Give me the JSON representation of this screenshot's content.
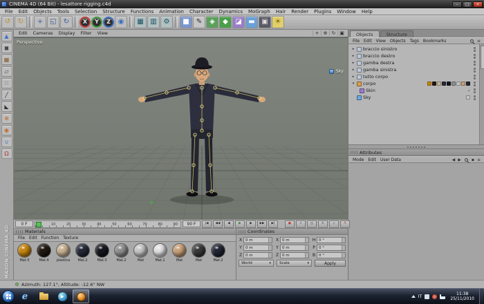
{
  "window": {
    "title": "CINEMA 4D (64 Bit) - lesattore rigging.c4d",
    "minimize": "–",
    "maximize": "□",
    "close": "×"
  },
  "menu_bar": {
    "items": [
      "File",
      "Edit",
      "Objects",
      "Tools",
      "Selection",
      "Structure",
      "Functions",
      "Animation",
      "Character",
      "Dynamics",
      "MoGraph",
      "Hair",
      "Render",
      "Plugins",
      "Window",
      "Help"
    ]
  },
  "toolbar": {
    "icons": [
      {
        "name": "undo",
        "glyph": "↺",
        "fg": "#b8922e",
        "bg": "#bdbdbd"
      },
      {
        "name": "redo",
        "glyph": "↻",
        "fg": "#b8922e",
        "bg": "#bdbdbd"
      },
      {
        "name": "move",
        "glyph": "+",
        "fg": "#3f5e9e",
        "bg": "#bdbdbd"
      },
      {
        "name": "scale",
        "glyph": "◱",
        "fg": "#3f5e9e",
        "bg": "#bdbdbd"
      },
      {
        "name": "rotate",
        "glyph": "↻",
        "fg": "#3f5e9e",
        "bg": "#bdbdbd"
      },
      {
        "name": "lock-x",
        "glyph": "X",
        "fg": "#e8e8e8",
        "bg": "#2e2e2e",
        "ring": "#c04040"
      },
      {
        "name": "lock-y",
        "glyph": "Y",
        "fg": "#e8e8e8",
        "bg": "#2e2e2e",
        "ring": "#3f9e3f"
      },
      {
        "name": "lock-z",
        "glyph": "Z",
        "fg": "#e8e8e8",
        "bg": "#2e2e2e",
        "ring": "#3a6fc2"
      },
      {
        "name": "coordinate-system",
        "glyph": "◉",
        "fg": "#3a6fc2",
        "bg": "#bdbdbd"
      },
      {
        "name": "render-view",
        "glyph": "▦",
        "fg": "#16525e",
        "bg": "#b3c0c2"
      },
      {
        "name": "render-picture-viewer",
        "glyph": "▥",
        "fg": "#16525e",
        "bg": "#b3c0c2"
      },
      {
        "name": "render-settings",
        "glyph": "⚙",
        "fg": "#16525e",
        "bg": "#b3c0c2"
      },
      {
        "name": "add-primitive",
        "glyph": "■",
        "fg": "#ffffff",
        "bg": "#7d97cd"
      },
      {
        "name": "add-spline",
        "glyph": "✎",
        "fg": "#2e2e2e",
        "bg": "#c6c6c6"
      },
      {
        "name": "add-nurbs",
        "glyph": "◈",
        "fg": "#ffffff",
        "bg": "#5aa05a"
      },
      {
        "name": "add-modeling",
        "glyph": "◆",
        "fg": "#ffffff",
        "bg": "#49a049"
      },
      {
        "name": "add-deformer",
        "glyph": "◪",
        "fg": "#ffffff",
        "bg": "#9a7ec8"
      },
      {
        "name": "add-environment",
        "glyph": "▬",
        "fg": "#ffffff",
        "bg": "#6aa0d8"
      },
      {
        "name": "add-camera",
        "glyph": "▣",
        "fg": "#e0e0e0",
        "bg": "#5a5a66"
      },
      {
        "name": "add-light",
        "glyph": "☀",
        "fg": "#7a5f10",
        "bg": "#e0cf6a"
      }
    ]
  },
  "left_toolbar": {
    "brand": "MAXON CINEMA 4D",
    "icons": [
      {
        "name": "make-editable",
        "glyph": "▲",
        "fg": "#3f6fd0"
      },
      {
        "name": "model-mode",
        "glyph": "◼",
        "fg": "#4a4a4a"
      },
      {
        "name": "texture-mode",
        "glyph": "▦",
        "fg": "#8a5a2a"
      },
      {
        "name": "workplane-mode",
        "glyph": "▱",
        "fg": "#4a4a4a"
      },
      {
        "name": "points-mode",
        "glyph": "∷",
        "fg": "#333333"
      },
      {
        "name": "edges-mode",
        "glyph": "╱",
        "fg": "#333333"
      },
      {
        "name": "polygons-mode",
        "glyph": "◣",
        "fg": "#333333"
      },
      {
        "name": "enable-axis",
        "glyph": "⊕",
        "fg": "#c06a2a"
      },
      {
        "name": "coordinate-lock",
        "glyph": "◉",
        "fg": "#c06a2a"
      },
      {
        "name": "snap",
        "glyph": "∪",
        "fg": "#3a6fc2"
      },
      {
        "name": "magnet",
        "glyph": "Ω",
        "fg": "#b03030"
      }
    ]
  },
  "viewport": {
    "name_label": "Perspective",
    "menu": [
      "Edit",
      "Cameras",
      "Display",
      "Filter",
      "View"
    ],
    "nav_icons": [
      {
        "name": "pan-view",
        "glyph": "+"
      },
      {
        "name": "zoom-view",
        "glyph": "⊕"
      },
      {
        "name": "orbit-view",
        "glyph": "↻"
      },
      {
        "name": "toggle-panels",
        "glyph": "▣"
      }
    ],
    "sky_label": "Sky"
  },
  "objects_panel": {
    "tabs": [
      "Objects",
      "Structure"
    ],
    "menu": [
      "File",
      "Edit",
      "View",
      "Objects",
      "Tags",
      "Bookmarks"
    ],
    "items": [
      {
        "label": "braccio sinistro",
        "expand": "▸",
        "icon_color": "#bcc8da"
      },
      {
        "label": "braccio destro",
        "expand": "▸",
        "icon_color": "#bcc8da"
      },
      {
        "label": "gamba destra",
        "expand": "▸",
        "icon_color": "#bcc8da"
      },
      {
        "label": "gamba sinistra",
        "expand": "▸",
        "icon_color": "#bcc8da"
      },
      {
        "label": "tutto corpo",
        "expand": "▸",
        "icon_color": "#bcc8da"
      },
      {
        "label": "corpo",
        "expand": "▾",
        "icon_color": "#d8a050"
      },
      {
        "label": "Skin",
        "expand": "",
        "icon_color": "#9a7ed0",
        "check": "✓"
      },
      {
        "label": "Sky",
        "expand": "",
        "icon_color": "#6aa8e0"
      }
    ],
    "corpo_tags": [
      "#c8860f",
      "#221812",
      "#c8b294",
      "#262a38",
      "#16181f",
      "#909090",
      "#c6c6c6",
      "#c9a179",
      "#222634"
    ],
    "sky_tag": "#c6c6c6"
  },
  "attributes_panel": {
    "title": "Attributes",
    "menu": [
      "Mode",
      "Edit",
      "User Data"
    ],
    "icons": [
      {
        "name": "nav-back",
        "glyph": "◀"
      },
      {
        "name": "nav-forward",
        "glyph": "▶"
      },
      {
        "name": "lock",
        "glyph": "▪"
      },
      {
        "name": "options",
        "glyph": "≡"
      }
    ]
  },
  "timeline": {
    "current_frame": "0 F",
    "end_frame": "90 F",
    "ticks": [
      "0",
      "10",
      "20",
      "30",
      "40",
      "50",
      "60",
      "70",
      "80",
      "90"
    ],
    "transport": [
      {
        "name": "goto-start",
        "glyph": "|◀",
        "fg": "#222222"
      },
      {
        "name": "prev-key",
        "glyph": "◀◀",
        "fg": "#222222"
      },
      {
        "name": "prev-frame",
        "glyph": "◀",
        "fg": "#222222"
      },
      {
        "name": "play",
        "glyph": "▶",
        "fg": "#157f2a"
      },
      {
        "name": "next-frame",
        "glyph": "▶",
        "fg": "#222222"
      },
      {
        "name": "next-key",
        "glyph": "▶▶",
        "fg": "#222222"
      },
      {
        "name": "goto-end",
        "glyph": "▶|",
        "fg": "#222222"
      }
    ],
    "record": [
      {
        "name": "record-keyframe",
        "glyph": "●",
        "fg": "#c03030"
      },
      {
        "name": "record-position",
        "glyph": "+",
        "fg": "#33425a"
      },
      {
        "name": "record-scale",
        "glyph": "◱",
        "fg": "#33425a"
      },
      {
        "name": "record-rotation",
        "glyph": "↻",
        "fg": "#33425a"
      },
      {
        "name": "record-parameter",
        "glyph": "◇",
        "fg": "#33425a"
      },
      {
        "name": "autokey",
        "glyph": "A",
        "fg": "#b03030"
      }
    ]
  },
  "materials_panel": {
    "title": "Materials",
    "menu": [
      "File",
      "Edit",
      "Function",
      "Texture"
    ],
    "items": [
      {
        "name": "Mat.5",
        "color": "#c8860f"
      },
      {
        "name": "Mat.4",
        "color": "#221812"
      },
      {
        "name": "plastica",
        "color": "#c8b294"
      },
      {
        "name": "Mat.2",
        "color": "#262a38"
      },
      {
        "name": "Mat.3",
        "color": "#16181f"
      },
      {
        "name": "Mat.2",
        "color": "#909090"
      },
      {
        "name": "Mat",
        "color": "#c6c6c6"
      },
      {
        "name": "Mat.1",
        "color": "#e2e2e2"
      },
      {
        "name": "Mat",
        "color": "#c9a179"
      },
      {
        "name": "Mat",
        "color": "#3a3a3a"
      },
      {
        "name": "Mat.2",
        "color": "#222634"
      }
    ]
  },
  "coordinates_panel": {
    "title": "Coordinates",
    "position": {
      "labels": [
        "X",
        "Y",
        "Z"
      ],
      "values": [
        "0 m",
        "0 m",
        "0 m"
      ]
    },
    "size": {
      "labels": [
        "X",
        "Y",
        "Z"
      ],
      "values": [
        "0 m",
        "0 m",
        "0 m"
      ]
    },
    "rotation": {
      "labels": [
        "H",
        "P",
        "B"
      ],
      "values": [
        "0 °",
        "0 °",
        "0 °"
      ]
    },
    "mode_label": "World",
    "scale_label": "Scale",
    "apply_label": "Apply"
  },
  "status_bar": {
    "text": "Azimuth: 127.1°, Altitude: -12.6°   NW"
  },
  "taskbar": {
    "ie_glyph": "e",
    "media_glyph": "▶",
    "language": "IT",
    "time": "11:38",
    "date": "25/11/2010"
  }
}
